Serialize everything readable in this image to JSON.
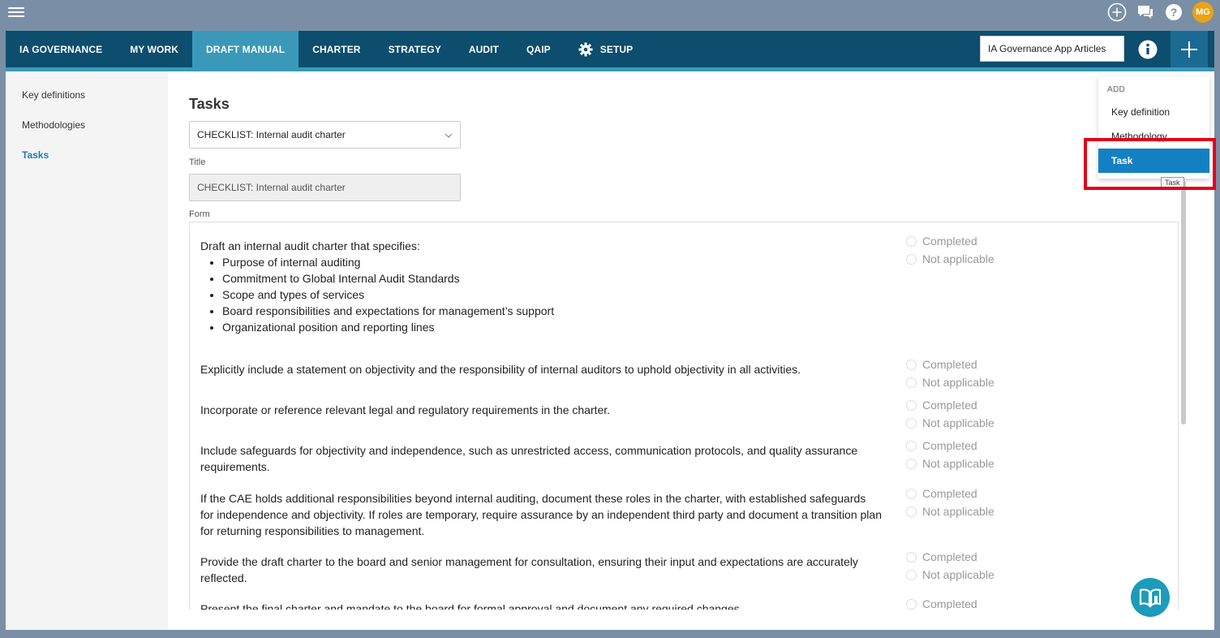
{
  "topbar": {
    "avatar_initials": "MG"
  },
  "nav": {
    "items": [
      {
        "label": "IA GOVERNANCE"
      },
      {
        "label": "MY WORK"
      },
      {
        "label": "DRAFT MANUAL"
      },
      {
        "label": "CHARTER"
      },
      {
        "label": "STRATEGY"
      },
      {
        "label": "AUDIT"
      },
      {
        "label": "QAIP"
      },
      {
        "label": "SETUP"
      }
    ],
    "active": "DRAFT MANUAL",
    "search_value": "IA Governance App Articles"
  },
  "sidebar": {
    "items": [
      {
        "label": "Key definitions"
      },
      {
        "label": "Methodologies"
      },
      {
        "label": "Tasks"
      }
    ],
    "active": "Tasks"
  },
  "main": {
    "title": "Tasks",
    "select_value": "CHECKLIST: Internal audit charter",
    "title_label": "Title",
    "title_value": "CHECKLIST: Internal audit charter",
    "form_label": "Form",
    "option_completed": "Completed",
    "option_na": "Not applicable",
    "tasks": [
      {
        "text": "Draft an internal audit charter that specifies:",
        "bullets": [
          "Purpose of internal auditing",
          "Commitment to Global Internal Audit Standards",
          "Scope and types of services",
          "Board responsibilities and expectations for management’s support",
          "Organizational position and reporting lines"
        ]
      },
      {
        "text": "Explicitly include a statement on objectivity and the responsibility of internal auditors to uphold objectivity in all activities."
      },
      {
        "text": "Incorporate or reference relevant legal and regulatory requirements in the charter."
      },
      {
        "text": "Include safeguards for objectivity and independence, such as unrestricted access, communication protocols, and quality assurance requirements."
      },
      {
        "text": "If the CAE holds additional responsibilities beyond internal auditing, document these roles in the charter, with established safeguards for independence and objectivity. If roles are temporary, require assurance by an independent third party and document a transition plan for returning responsibilities to management."
      },
      {
        "text": "Provide the draft charter to the board and senior management for consultation, ensuring their input and expectations are accurately reflected."
      },
      {
        "text": "Present the final charter and mandate to the board for formal approval and document any required changes."
      }
    ]
  },
  "add_menu": {
    "header": "ADD",
    "items": [
      {
        "label": "Key definition"
      },
      {
        "label": "Methodology"
      },
      {
        "label": "Task"
      }
    ],
    "active": "Task",
    "tooltip": "Task"
  },
  "colors": {
    "nav_bg": "#0d4d6e",
    "nav_active": "#3a99b9",
    "menu_active": "#1480c4",
    "highlight": "#e3001b"
  }
}
